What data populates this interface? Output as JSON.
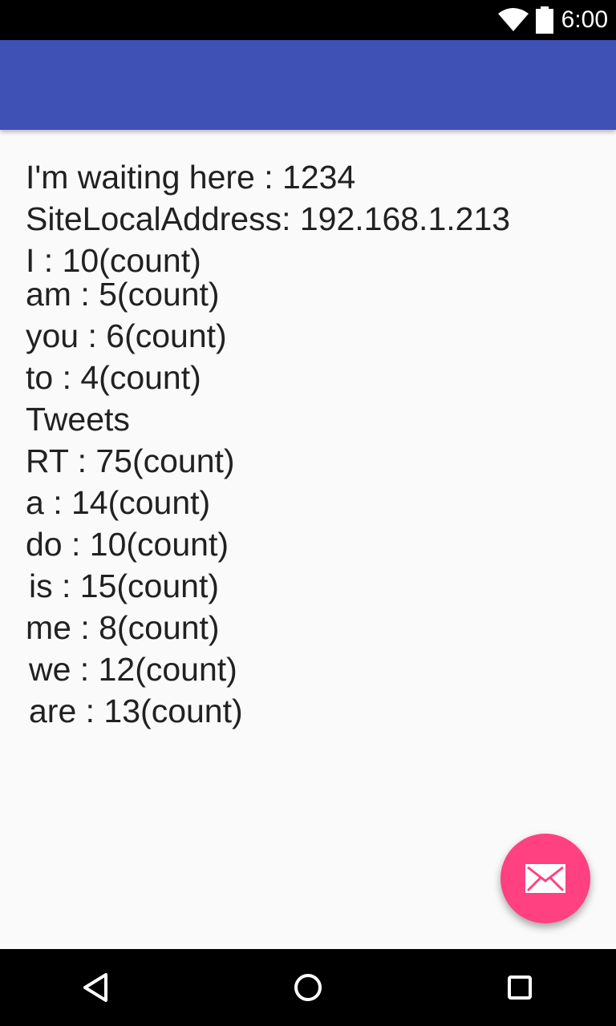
{
  "status_bar": {
    "time": "6:00",
    "icons": [
      "wifi-icon",
      "battery-icon"
    ]
  },
  "app_bar": {
    "color": "#3f51b5"
  },
  "content": {
    "lines": [
      "I'm waiting here : 1234",
      "SiteLocalAddress: 192.168.1.213",
      "I : 10(count)",
      "am : 5(count)",
      "you : 6(count)",
      "to : 4(count)",
      "Tweets",
      "RT : 75(count)",
      "a : 14(count)",
      "do : 10(count)",
      "is : 15(count)",
      "me : 8(count)",
      "we : 12(count)",
      "are : 13(count)"
    ]
  },
  "fab": {
    "icon": "mail-icon",
    "color": "#ff4081"
  },
  "nav_bar": {
    "buttons": [
      "back-icon",
      "home-icon",
      "recents-icon"
    ]
  }
}
